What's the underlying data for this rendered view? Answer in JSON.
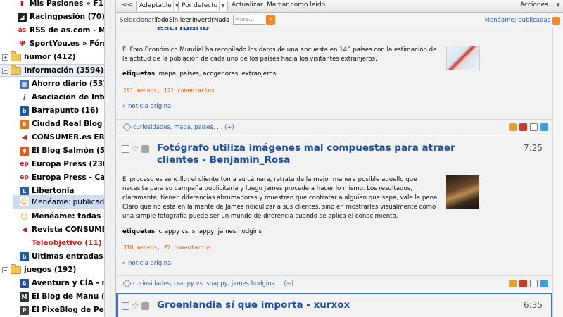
{
  "sidebar": {
    "items": [
      {
        "label": "Mis Pasiones » F1 (1...",
        "icon": "f1-favicon",
        "color": "#c01a1a"
      },
      {
        "label": "Racingpasión (70)",
        "icon": "racingpasion-favicon",
        "color": "#333333"
      },
      {
        "label": "RSS de as.com - Mot",
        "icon": "as-favicon",
        "color": "#d11818"
      },
      {
        "label": "SportYou.es » Fórmu",
        "icon": "sportyou-favicon",
        "color": "#d11818"
      },
      {
        "label": "humor (412)",
        "icon": "folder-icon",
        "toggle": "+"
      },
      {
        "label": "Información (3594)",
        "icon": "folder-open-icon",
        "toggle": "−"
      },
      {
        "label": "Ahorro diario (53)",
        "icon": "ahorro-favicon",
        "color": "#4a6fa5"
      },
      {
        "label": "Asociacion de Intern",
        "icon": "asociacion-favicon",
        "color": "#3b6ab1"
      },
      {
        "label": "Barrapunto (16)",
        "icon": "barrapunto-favicon",
        "color": "#1b5a9c"
      },
      {
        "label": "Ciudad Real Blog - w",
        "icon": "blogger-favicon",
        "color": "#e07322"
      },
      {
        "label": "CONSUMER.es EROS",
        "icon": "consumer-favicon",
        "color": "#c0202a"
      },
      {
        "label": "El Blog Salmón (57)",
        "icon": "salmon-favicon",
        "color": "#e0572a"
      },
      {
        "label": "Europa Press (236)",
        "icon": "ep-favicon",
        "color": "#c81b1b"
      },
      {
        "label": "Europa Press - Castil",
        "icon": "ep-favicon",
        "color": "#c81b1b"
      },
      {
        "label": "Libertonia",
        "icon": "libertonia-favicon",
        "color": "#2c5d9f"
      },
      {
        "label": "Menéame: publicadas",
        "icon": "meneame-favicon",
        "color": "#f29a33"
      },
      {
        "label": "Menéame: todas (294",
        "icon": "meneame-favicon",
        "color": "#f29a33"
      },
      {
        "label": "Revista CONSUMER",
        "icon": "consumer-favicon",
        "color": "#c0202a"
      },
      {
        "label": "Teleobjetivo (11)",
        "icon": "none"
      },
      {
        "label": "Ultimas entradas en",
        "icon": "barrapunto-favicon",
        "color": "#1b5a9c"
      },
      {
        "label": "juegos (192)",
        "icon": "folder-open-icon",
        "toggle": "−"
      },
      {
        "label": "Aventura y CÍA - notic",
        "icon": "aventura-favicon",
        "color": "#2f4f8f"
      },
      {
        "label": "El Blog de Manu (11)",
        "icon": "blogmanu-favicon",
        "color": "#333333"
      },
      {
        "label": "El PixeBlog de Pedja",
        "icon": "pixeblog-favicon",
        "color": "#444444"
      }
    ]
  },
  "toolbar": {
    "collapse": "<<",
    "adaptable": "Adaptable",
    "default": "Por defecto",
    "refresh": "Actualizar",
    "mark_read": "Marcar como leído",
    "actions": "Acciones..."
  },
  "selectbar": {
    "label": "Seleccionar:",
    "all": "Todo",
    "unread": "Sin leer",
    "invert": "Invertir",
    "none": "Nada",
    "more": "More...",
    "feed": "Menéame: publicadas"
  },
  "articles": [
    {
      "title_tail": "escribano",
      "body": "El Foro Económico Mundial ha recopilado los datos de una encuesta en 140 países con la estimación de la actitud de la población de cada uno de los países hacia los visitantes extranjeros.",
      "tags_label": "etiquetas",
      "tags": "mapa, países, acogedores, extranjeros",
      "votes": "291 meneos, 121 comentarios",
      "orig": "» noticia original",
      "footer_tags": "curiosidades, mapa, países, … (+)"
    },
    {
      "title": "Fotógrafo utiliza imágenes mal compuestas para atraer clientes - Benjamin_Rosa",
      "time": "7:25",
      "body": "El proceso es sencillo: el cliente toma su cámara, retrata de la mejor manera posible aquello que necesita para su campaña publicitaria y luego James procede a hacer lo mismo. Los resultados, claramente, tienen diferencias abrumadoras y muestran que contratar a alguien que sepa, vale la pena. Claro que no está en la mente de James ridiculizar a sus clientes, sino en mostrarles visualmente cómo una simple fotografía puede ser un mundo de diferencia cuando se aplica el conocimiento.",
      "tags_label": "etiquetas",
      "tags": "crappy vs. snappy, james hodgins",
      "votes": "318 meneos, 72 comentarios",
      "orig": "» noticia original",
      "footer_tags": "curiosidades, crappy vs. snappy, james hodgins … (+)"
    },
    {
      "title": "Groenlandia sí que importa - xurxox",
      "time": "6:35"
    }
  ]
}
